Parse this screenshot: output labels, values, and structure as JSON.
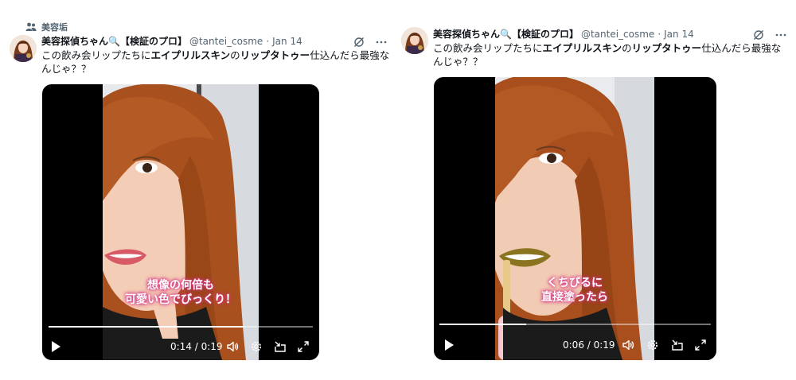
{
  "social_context": {
    "label": "美容垢",
    "icon": "people-icon"
  },
  "tweets": [
    {
      "author_name": "美容探偵ちゃん🔍【検証のプロ】",
      "handle": "@tantei_cosme",
      "date": "Jan 14",
      "text_parts": [
        "この飲み会リップたちに",
        "エイプリルスキン",
        "の",
        "リップタトゥー",
        "仕込んだら最強なんじゃ？？"
      ],
      "video": {
        "caption_line1": "想像の何倍も",
        "caption_line2": "可愛い色でびっくり！",
        "time": "0:14 / 0:19",
        "progress": 0.74
      }
    },
    {
      "author_name": "美容探偵ちゃん🔍【検証のプロ】",
      "handle": "@tantei_cosme",
      "date": "Jan 14",
      "text_parts": [
        "この飲み会リップたちに",
        "エイプリルスキン",
        "の",
        "リップタトゥー",
        "仕込んだら最強なんじゃ？？"
      ],
      "video": {
        "caption_line1": "くちびるに",
        "caption_line2": "直接塗ったら",
        "time": "0:06 / 0:19",
        "progress": 0.32
      }
    }
  ],
  "colors": {
    "text": "#0f1419",
    "muted": "#536471",
    "video_bg": "#000000",
    "caption_glow": "#d0307a"
  }
}
